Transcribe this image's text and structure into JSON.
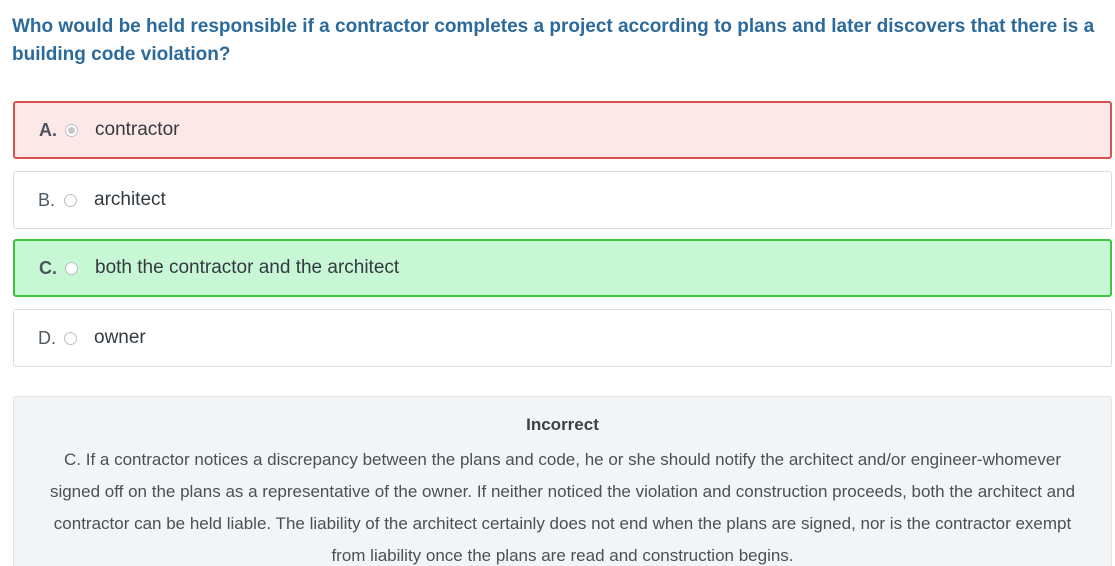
{
  "question": {
    "text": "Who would be held responsible if a contractor completes a project according to plans and later discovers that there is a building code violation?"
  },
  "options": [
    {
      "letter": "A.",
      "text": "contractor",
      "state": "selected-incorrect"
    },
    {
      "letter": "B.",
      "text": "architect",
      "state": "neutral"
    },
    {
      "letter": "C.",
      "text": "both the contractor and the architect",
      "state": "correct"
    },
    {
      "letter": "D.",
      "text": "owner",
      "state": "neutral"
    }
  ],
  "feedback": {
    "title": "Incorrect",
    "body": "C. If a contractor notices a discrepancy between the plans and code, he or she should notify the architect and/or engineer-whomever signed off on the plans as a representative of the owner. If neither noticed the violation and construction proceeds, both the architect and contractor can be held liable. The liability of the architect certainly does not end when the plans are signed, nor is the contractor exempt from liability once the plans are read and construction begins."
  },
  "colors": {
    "question_text": "#2c6a9b",
    "incorrect_border": "#d9534f",
    "incorrect_bg": "#fde8e8",
    "correct_border": "#3fc43f",
    "correct_bg": "#c8f7d6"
  }
}
